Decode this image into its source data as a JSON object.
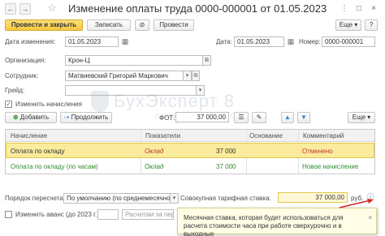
{
  "window": {
    "title": "Изменение оплаты труда 0000-000001 от 01.05.2023",
    "more_icon": "⋮",
    "expand_icon": "□",
    "close_icon": "×"
  },
  "toolbar": {
    "post_close": "Провести и закрыть",
    "save": "Записать",
    "post": "Провести",
    "more": "Еще",
    "help": "?"
  },
  "form": {
    "change_date_label": "Дата изменения:",
    "change_date": "01.05.2023",
    "date_label": "Дата:",
    "date": "01.05.2023",
    "number_label": "Номер:",
    "number": "0000-000001",
    "org_label": "Организация:",
    "org": "Крон-Ц",
    "employee_label": "Сотрудник:",
    "employee": "Матвиевский Григорий Маркович",
    "grade_label": "Грейд:",
    "grade": "",
    "change_accruals_label": "Изменить начисления",
    "change_accruals_checked": true
  },
  "table_toolbar": {
    "add": "Добавить",
    "extend": "Продолжить",
    "fot_label": "ФОТ:",
    "fot_value": "37 000,00",
    "more": "Еще"
  },
  "table": {
    "headers": [
      "Начисление",
      "Показатели",
      "Основание",
      "Комментарий"
    ],
    "rows": [
      {
        "accrual": "Оплата по окладу",
        "indicator": "Оклад",
        "amount": "37 000",
        "comment": "Отменено",
        "comment_color": "#c0392b",
        "selected": true
      },
      {
        "accrual": "Оплата по окладу (по часам)",
        "indicator": "Оклад",
        "amount": "37 000",
        "comment": "Новое начисление",
        "comment_color": "#2e8b2e",
        "selected": false
      }
    ]
  },
  "bottom": {
    "recalc_label": "Порядок пересчета:",
    "recalc_value": "По умолчанию (по среднемесячному",
    "rate_label": "Совокупная тарифная ставка:",
    "rate_value": "37 000,00",
    "rate_unit": "руб.",
    "advance_label": "Изменить аванс (до 2023 г.)",
    "advance_checked": false,
    "advance_field": "",
    "calc_placeholder": "Расчетам за первую поло"
  },
  "tooltip": {
    "text": "Месячная ставка, которая будет использоваться для расчета стоимости часа при работе сверхурочно и в выходные",
    "close": "×"
  },
  "watermark": {
    "main": "БухЭксперт 8",
    "sub": "ответов по учету в 1С"
  }
}
